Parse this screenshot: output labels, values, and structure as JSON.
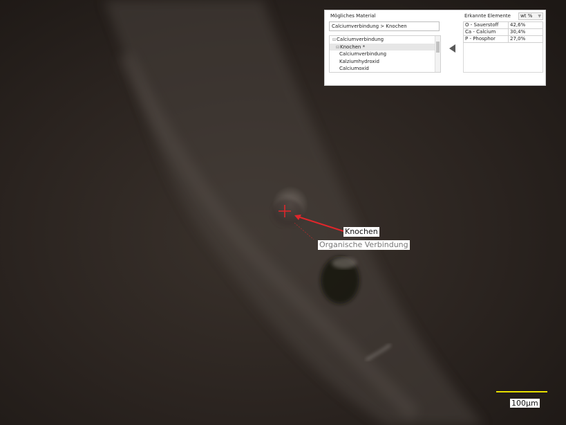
{
  "material_section": {
    "title": "Mögliches Material",
    "path": "Calciumverbindung > Knochen",
    "tree": [
      {
        "label": "Calciumverbindung",
        "toggle": "⊟",
        "indent": 0,
        "selected": false
      },
      {
        "label": "Knochen *",
        "toggle": "⊟",
        "indent": 1,
        "selected": true
      },
      {
        "label": "Calciumverbindung",
        "toggle": "",
        "indent": 2,
        "selected": false
      },
      {
        "label": "Kalziumhydroxid",
        "toggle": "",
        "indent": 2,
        "selected": false
      },
      {
        "label": "Calciumoxid",
        "toggle": "",
        "indent": 2,
        "selected": false
      }
    ]
  },
  "elements_section": {
    "title": "Erkannte Elemente",
    "unit": "wt %",
    "rows": [
      {
        "element": "O - Sauerstoff",
        "value": "42,6%"
      },
      {
        "element": "Ca - Calcium",
        "value": "30,4%"
      },
      {
        "element": "P - Phosphor",
        "value": "27,0%"
      }
    ]
  },
  "annotations": {
    "primary_label": "Knochen",
    "secondary_label": "Organische Verbindung",
    "marker_color": "#e0262b"
  },
  "scalebar": {
    "label": "100µm",
    "color": "#e8e000"
  }
}
